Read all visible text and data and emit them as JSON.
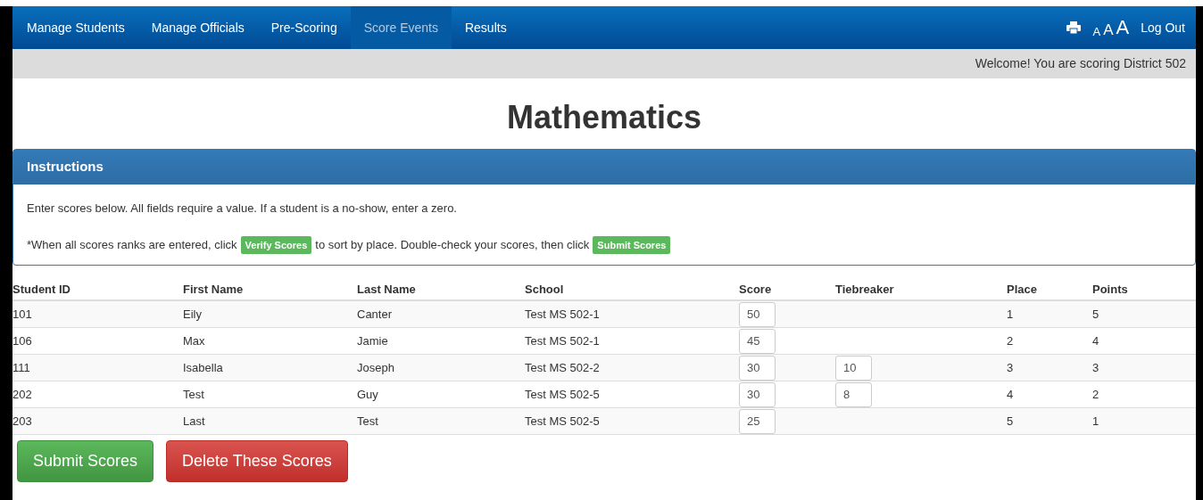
{
  "nav": {
    "items": [
      {
        "label": "Manage Students",
        "selected": false
      },
      {
        "label": "Manage Officials",
        "selected": false
      },
      {
        "label": "Pre-Scoring",
        "selected": false
      },
      {
        "label": "Score Events",
        "selected": true
      },
      {
        "label": "Results",
        "selected": false
      }
    ],
    "font_sizes": [
      "A",
      "A",
      "A"
    ],
    "logout": "Log Out"
  },
  "welcome": "Welcome! You are scoring District 502",
  "title": "Mathematics",
  "instructions": {
    "heading": "Instructions",
    "line_1": "Enter scores below. All fields require a value. If a student is a no-show, enter a zero.",
    "line_2_before": "*When all scores ranks are entered, click",
    "verify_label": "Verify Scores",
    "line_2_middle": "to sort by place. Double-check your scores, then click",
    "submit_label": "Submit Scores"
  },
  "table": {
    "columns": [
      "Student ID",
      "First Name",
      "Last Name",
      "School",
      "Score",
      "Tiebreaker",
      "Place",
      "Points"
    ],
    "rows": [
      {
        "student_id": "101",
        "first_name": "Eily",
        "last_name": "Canter",
        "school": "Test MS 502-1",
        "score": "50",
        "place": "1",
        "points": "5"
      },
      {
        "student_id": "106",
        "first_name": "Max",
        "last_name": "Jamie",
        "school": "Test MS 502-1",
        "score": "45",
        "place": "2",
        "points": "4"
      },
      {
        "student_id": "111",
        "first_name": "Isabella",
        "last_name": "Joseph",
        "school": "Test MS 502-2",
        "score": "30",
        "tiebreaker": "10",
        "place": "3",
        "points": "3"
      },
      {
        "student_id": "202",
        "first_name": "Test",
        "last_name": "Guy",
        "school": "Test MS 502-5",
        "score": "30",
        "tiebreaker": "8",
        "place": "4",
        "points": "2"
      },
      {
        "student_id": "203",
        "first_name": "Last",
        "last_name": "Test",
        "school": "Test MS 502-5",
        "score": "25",
        "place": "5",
        "points": "1"
      }
    ]
  },
  "buttons": {
    "submit": "Submit Scores",
    "delete": "Delete These Scores"
  }
}
